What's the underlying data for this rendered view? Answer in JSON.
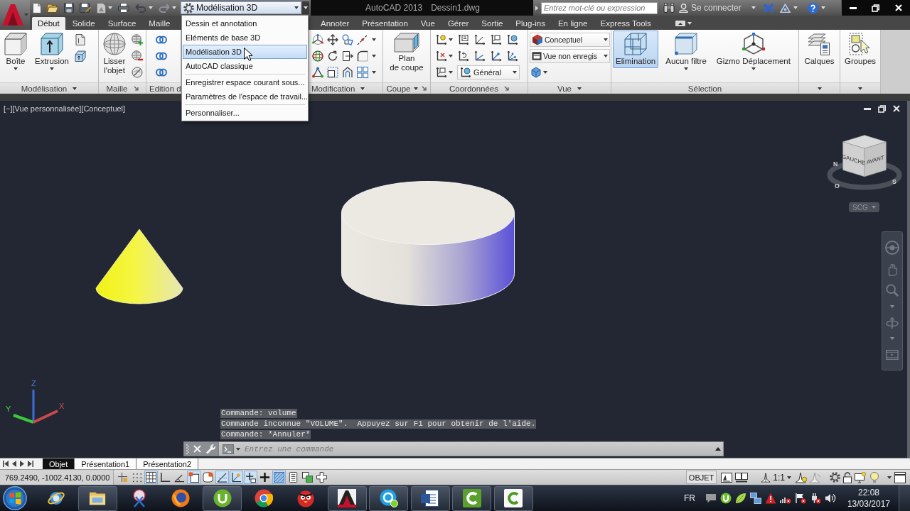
{
  "title_bar": {
    "workspace": "Modélisation 3D",
    "app_title": "AutoCAD 2013",
    "file_name": "Dessin1.dwg",
    "search": {
      "placeholder": "Entrez mot-clé ou expression"
    },
    "sign_in": "Se connecter"
  },
  "workspace_menu": {
    "groups": [
      {
        "items": [
          {
            "label": "Dessin et annotation",
            "selected": false
          },
          {
            "label": "Eléments de base 3D",
            "selected": false
          },
          {
            "label": "Modélisation 3D",
            "selected": true
          },
          {
            "label": "AutoCAD classique",
            "selected": false
          }
        ]
      },
      {
        "items": [
          {
            "label": "Enregistrer espace courant sous...",
            "selected": false
          },
          {
            "label": "Paramètres de l'espace de travail...",
            "selected": false
          }
        ]
      },
      {
        "items": [
          {
            "label": "Personnaliser...",
            "selected": false
          }
        ]
      }
    ]
  },
  "ribbon_tabs": [
    {
      "label": "Début",
      "selected": true
    },
    {
      "label": "Solide",
      "selected": false
    },
    {
      "label": "Surface",
      "selected": false
    },
    {
      "label": "Maille",
      "selected": false
    },
    {
      "label": "Annoter",
      "selected": false
    },
    {
      "label": "Présentation",
      "selected": false
    },
    {
      "label": "Vue",
      "selected": false
    },
    {
      "label": "Gérer",
      "selected": false
    },
    {
      "label": "Sortie",
      "selected": false
    },
    {
      "label": "Plug-ins",
      "selected": false
    },
    {
      "label": "En ligne",
      "selected": false
    },
    {
      "label": "Express Tools",
      "selected": false
    }
  ],
  "ribbon": {
    "panels": [
      {
        "title": "Modélisation",
        "buttons": [
          {
            "label": "Boîte",
            "kind": "dropdown"
          },
          {
            "label": "Extrusion",
            "kind": "dropdown"
          }
        ]
      },
      {
        "title": "Maille",
        "buttons": [
          {
            "label": "Lisser\nl'objet",
            "kind": "plain"
          }
        ]
      },
      {
        "title": "Edition d"
      },
      {
        "title": "Modification"
      },
      {
        "title": "Coupe",
        "buttons": [
          {
            "label": "Plan\nde coupe",
            "kind": "plain"
          }
        ]
      },
      {
        "title": "Coordonnées",
        "dropdowns": [
          {
            "value": "Général"
          }
        ]
      },
      {
        "title": "Vue",
        "dropdowns": [
          {
            "value": "Conceptuel"
          },
          {
            "value": "Vue non enregis"
          }
        ]
      },
      {
        "title": "Sélection",
        "buttons": [
          {
            "label": "Elimination",
            "kind": "plain",
            "on": true
          },
          {
            "label": "Aucun filtre",
            "kind": "dropdown",
            "on": false
          },
          {
            "label": "Gizmo Déplacement",
            "kind": "dropdown",
            "on": false
          }
        ]
      },
      {
        "buttons": [
          {
            "label": "Calques",
            "kind": "plain"
          }
        ]
      },
      {
        "buttons": [
          {
            "label": "Groupes",
            "kind": "plain"
          }
        ]
      }
    ]
  },
  "viewport": {
    "label": "[−][Vue personnalisée][Conceptuel]",
    "view_cube": {
      "faces": [
        "GAUCHE",
        "AVANT"
      ],
      "compass": [
        "N",
        "O",
        "S"
      ]
    },
    "ucs_menu": "SCG",
    "axes": [
      "X",
      "Y",
      "Z"
    ]
  },
  "command_history": [
    "Commande: volume",
    "Commande inconnue \"VOLUME\".  Appuyez sur F1 pour obtenir de l'aide.",
    "Commande: *Annuler*"
  ],
  "command_line": {
    "placeholder": "Entrez une commande"
  },
  "layout_tabs": [
    {
      "label": "Objet",
      "selected": true
    },
    {
      "label": "Présentation1",
      "selected": false
    },
    {
      "label": "Présentation2",
      "selected": false
    }
  ],
  "status_bar": {
    "coordinates": "769.2490, -1002.4130, 0.0000",
    "toggles": [
      {
        "on": false
      },
      {
        "on": false
      },
      {
        "on": true
      },
      {
        "on": false
      },
      {
        "on": false
      },
      {
        "on": true
      },
      {
        "on": false
      },
      {
        "on": true
      },
      {
        "on": true
      },
      {
        "on": true
      },
      {
        "on": false
      },
      {
        "on": true
      },
      {
        "on": false
      },
      {
        "on": false
      },
      {
        "on": false
      }
    ],
    "space": "OBJET",
    "annotation_scale": "1:1"
  },
  "taskbar": {
    "apps": [
      {
        "running": false
      },
      {
        "running": true
      },
      {
        "running": false
      },
      {
        "running": false
      },
      {
        "running": true
      },
      {
        "running": false
      },
      {
        "running": false
      },
      {
        "running": true
      },
      {
        "running": true
      },
      {
        "running": true
      },
      {
        "running": true
      },
      {
        "running": true
      }
    ],
    "language": "FR",
    "time": "22:08",
    "date": "13/03/2017"
  }
}
